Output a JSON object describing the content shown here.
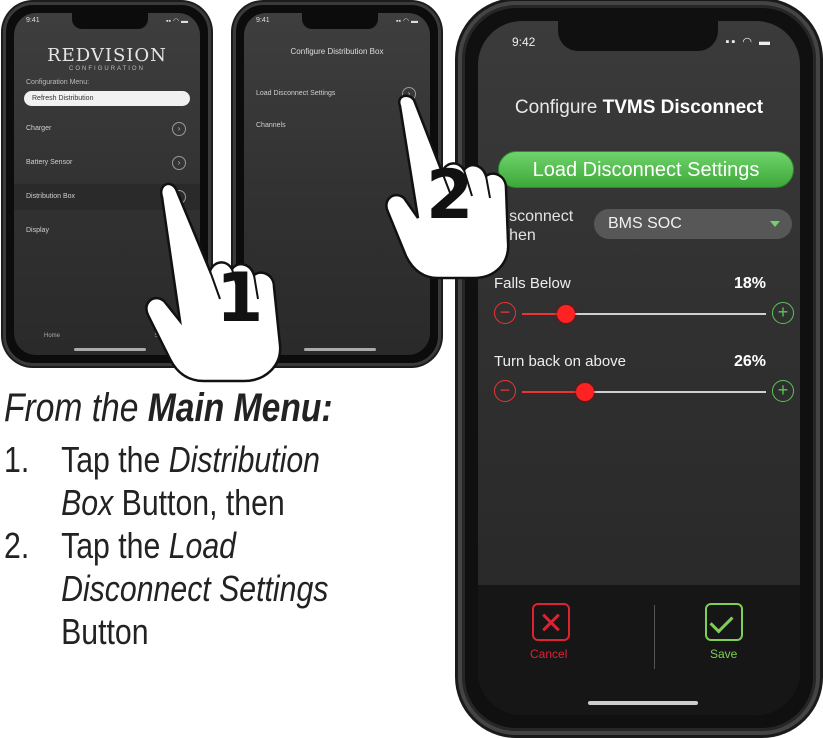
{
  "phone1": {
    "status_time": "9:41",
    "logo": "REDVISION",
    "logo_sub": "CONFIGURATION",
    "config_label": "Configuration Menu:",
    "selected_profile": "Refresh Distribution",
    "menu_items": [
      "Charger",
      "Battery Sensor",
      "Distribution Box",
      "Display"
    ],
    "footer_left": "Home",
    "footer_right": "Settings"
  },
  "phone2": {
    "status_time": "9:41",
    "header": "Configure Distribution Box",
    "rows": [
      "Load Disconnect Settings",
      "Channels"
    ]
  },
  "phone3": {
    "status_time": "9:42",
    "title_prefix": "Configure",
    "title_bold": "TVMS Disconnect",
    "load_button": "Load Disconnect Settings",
    "disconnect_when_label": "Disconnect When",
    "disconnect_when_value": "BMS SOC",
    "falls_below_label": "Falls Below",
    "falls_below_value": "18%",
    "falls_below_level": 0.18,
    "turn_back_label": "Turn back on above",
    "turn_back_value": "26%",
    "turn_back_level": 0.26,
    "cancel_label": "Cancel",
    "save_label": "Save"
  },
  "callouts": {
    "step1": "1",
    "step2": "2"
  },
  "instructions": {
    "intro_prefix": "From the",
    "intro_bold": "Main Menu:",
    "steps": [
      {
        "num": "1.",
        "line1_a": "Tap the",
        "line1_i": "Distribution",
        "line2_i": "Box",
        "line2_b": "Button, then"
      },
      {
        "num": "2.",
        "line1_a": "Tap the",
        "line1_i": "Load",
        "line2_i": "Disconnect Settings",
        "line3": "Button"
      }
    ]
  },
  "colors": {
    "accent_green": "#4fbf4b",
    "accent_red": "#e33333"
  }
}
